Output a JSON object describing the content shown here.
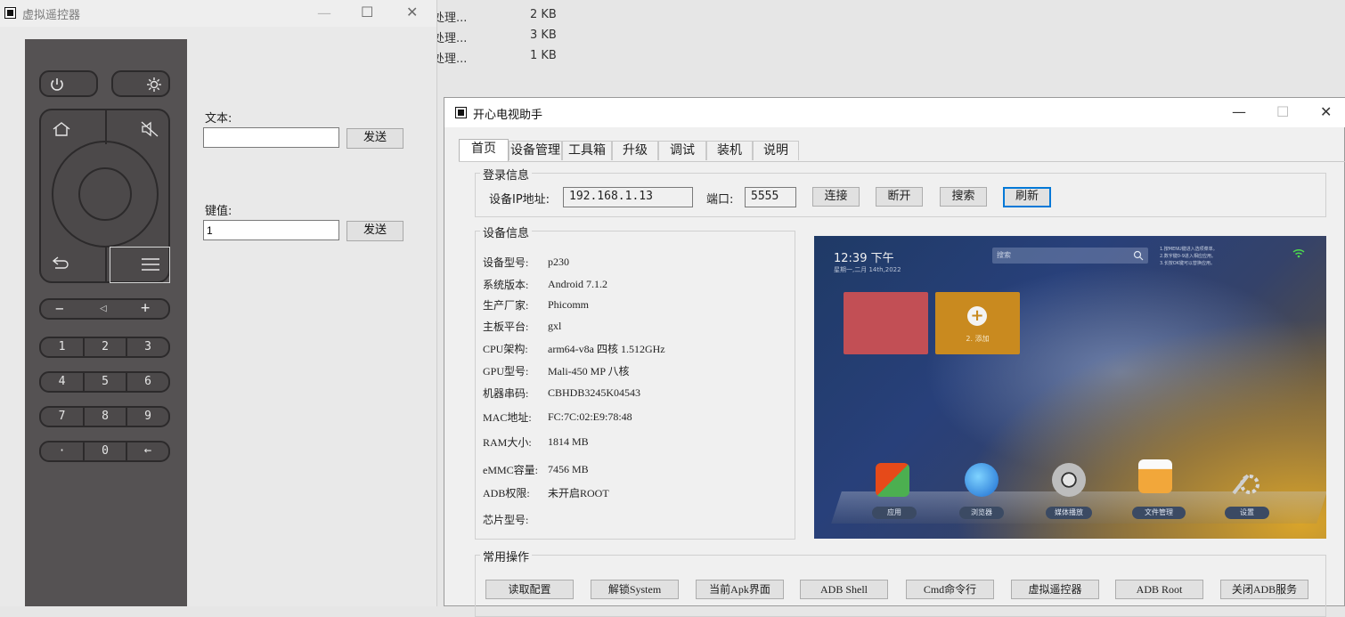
{
  "background_files": [
    {
      "name": "处理...",
      "size": "2 KB"
    },
    {
      "name": "处理...",
      "size": "3 KB"
    },
    {
      "name": "处理...",
      "size": "1 KB"
    }
  ],
  "remote_window": {
    "title": "虚拟遥控器",
    "controls": {
      "minimize": "—",
      "maximize": "☐",
      "close": "✕"
    },
    "text_label": "文本:",
    "text_value": "",
    "send_label": "发送",
    "key_label": "键值:",
    "key_value": "1",
    "send2_label": "发送",
    "remote": {
      "power_icon": "power-icon",
      "settings_icon": "gear-icon",
      "home_icon": "home-icon",
      "mute_icon": "mute-icon",
      "back_icon": "back-icon",
      "menu_icon": "menu-icon",
      "vol_minus": "−",
      "vol_icon": "◁",
      "vol_plus": "+",
      "digits": [
        "1",
        "2",
        "3",
        "4",
        "5",
        "6",
        "7",
        "8",
        "9",
        "·",
        "0",
        "←"
      ]
    }
  },
  "tv_window": {
    "title": "开心电视助手",
    "controls": {
      "minimize": "—",
      "maximize": "☐",
      "close": "✕"
    },
    "tabs": [
      "首页",
      "设备管理",
      "工具箱",
      "升级",
      "调试",
      "装机",
      "说明"
    ],
    "active_tab": "首页",
    "login": {
      "group_title": "登录信息",
      "ip_label": "设备IP地址:",
      "ip_value": "192.168.1.13",
      "port_label": "端口:",
      "port_value": "5555",
      "connect": "连接",
      "disconnect": "断开",
      "search": "搜索",
      "refresh": "刷新"
    },
    "device": {
      "group_title": "设备信息",
      "fields": [
        {
          "label": "设备型号:",
          "value": "p230"
        },
        {
          "label": "系统版本:",
          "value": "Android 7.1.2"
        },
        {
          "label": "生产厂家:",
          "value": "Phicomm"
        },
        {
          "label": "主板平台:",
          "value": "gxl"
        },
        {
          "label": "CPU架构:",
          "value": "arm64-v8a 四核 1.512GHz"
        },
        {
          "label": "GPU型号:",
          "value": "Mali-450 MP 八核"
        },
        {
          "label": "机器串码:",
          "value": "CBHDB3245K04543"
        },
        {
          "label": "MAC地址:",
          "value": "FC:7C:02:E9:78:48"
        },
        {
          "label": "RAM大小:",
          "value": "1814 MB"
        },
        {
          "label": "eMMC容量:",
          "value": "7456 MB"
        },
        {
          "label": "ADB权限:",
          "value": "未开启ROOT"
        },
        {
          "label": "芯片型号:",
          "value": ""
        }
      ]
    },
    "tv_preview": {
      "time": "12:39 下午",
      "date": "星期一,二月 14th,2022",
      "search_placeholder": "搜索",
      "hints": [
        "1.按MENU键进入选项菜单。",
        "2.数字键0-9进入相应应用。",
        "3.长按OK键可以替换应用。"
      ],
      "tile_add_label": "2. 添加",
      "dock": [
        "应用",
        "浏览器",
        "媒体播放",
        "文件管理",
        "设置"
      ]
    },
    "common_ops": {
      "group_title": "常用操作",
      "buttons": [
        "读取配置",
        "解锁System",
        "当前Apk界面",
        "ADB Shell",
        "Cmd命令行",
        "虚拟遥控器",
        "ADB  Root",
        "关闭ADB服务"
      ]
    }
  }
}
